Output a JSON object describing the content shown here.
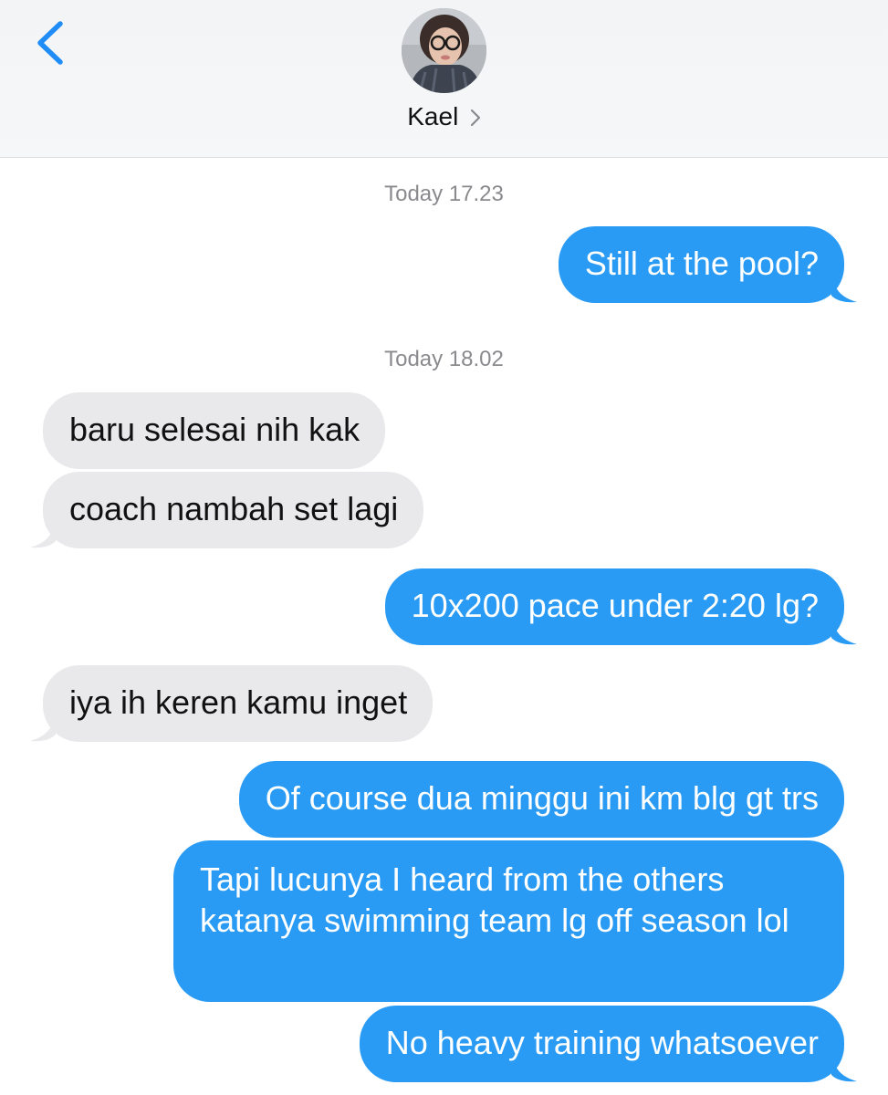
{
  "header": {
    "contact_name": "Kael",
    "back_icon": "chevron-left-icon",
    "name_chevron_icon": "chevron-right-icon"
  },
  "colors": {
    "sent_bubble": "#2a9bf4",
    "received_bubble": "#e9e9eb",
    "accent": "#1f8cf7",
    "timestamp": "#8a8a8e"
  },
  "timestamps": [
    "Today 17.23",
    "Today 18.02"
  ],
  "messages": [
    {
      "side": "sent",
      "text": "Still at the pool?"
    },
    {
      "side": "received",
      "text": "baru selesai nih kak"
    },
    {
      "side": "received",
      "text": "coach nambah set lagi"
    },
    {
      "side": "sent",
      "text": "10x200 pace under 2:20 lg?"
    },
    {
      "side": "received",
      "text": "iya ih keren kamu inget"
    },
    {
      "side": "sent",
      "text": "Of course dua minggu ini km blg gt trs"
    },
    {
      "side": "sent",
      "text": "Tapi lucunya I heard from the others katanya swimming team lg off season lol"
    },
    {
      "side": "sent",
      "text": "No heavy training whatsoever"
    }
  ]
}
